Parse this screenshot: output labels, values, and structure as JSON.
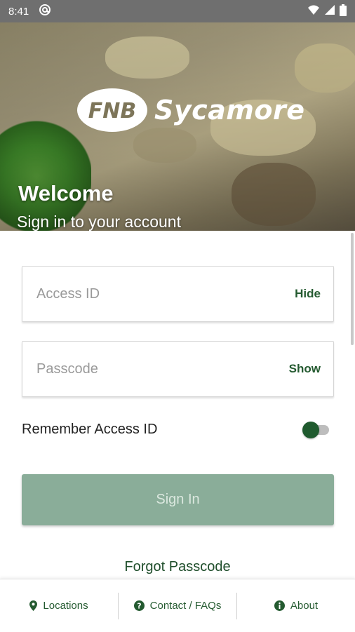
{
  "status_bar": {
    "time": "8:41",
    "icons": [
      "at-sign-icon",
      "wifi-icon",
      "signal-icon",
      "battery-icon"
    ]
  },
  "hero": {
    "logo_mark": "FNB",
    "logo_word": "Sycamore",
    "title": "Welcome",
    "subtitle": "Sign in to your account"
  },
  "form": {
    "access_id_placeholder": "Access ID",
    "access_id_value": "",
    "access_toggle_label": "Hide",
    "passcode_placeholder": "Passcode",
    "passcode_value": "",
    "passcode_toggle_label": "Show",
    "remember_label": "Remember Access ID",
    "remember_enabled": false,
    "sign_in_label": "Sign In",
    "forgot_label": "Forgot Passcode"
  },
  "bottom_nav": {
    "locations": "Locations",
    "contact": "Contact / FAQs",
    "about": "About"
  },
  "colors": {
    "brand_green": "#245a30",
    "button_disabled": "#8aad99",
    "status_bar": "#6f6f6f"
  }
}
